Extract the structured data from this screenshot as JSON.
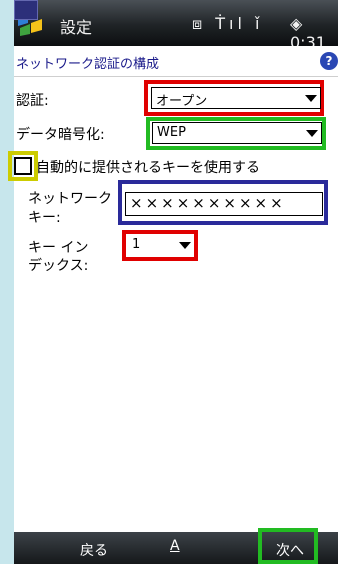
{
  "statusbar": {
    "title": "設定",
    "icons": "⧈ Ṫıl ǐ",
    "time": "◈ 0:31"
  },
  "header": {
    "title": "ネットワーク認証の構成",
    "help": "?"
  },
  "auth": {
    "label": "認証:",
    "value": "オープン"
  },
  "encryption": {
    "label": "データ暗号化:",
    "value": "WEP"
  },
  "auto_key": {
    "label": "自動的に提供されるキーを使用する"
  },
  "network_key": {
    "label_line1": "ネットワーク",
    "label_line2": "キー:",
    "value": "××××××××××"
  },
  "key_index": {
    "label_line1": "キー イン",
    "label_line2": "デックス:",
    "value": "1"
  },
  "softkeys": {
    "left": "戻る",
    "center": "A",
    "right": "次へ"
  },
  "highlights": {
    "red": "#e00000",
    "green": "#22bb22",
    "navy": "#2a2a9a",
    "olive": "#cccc00"
  }
}
